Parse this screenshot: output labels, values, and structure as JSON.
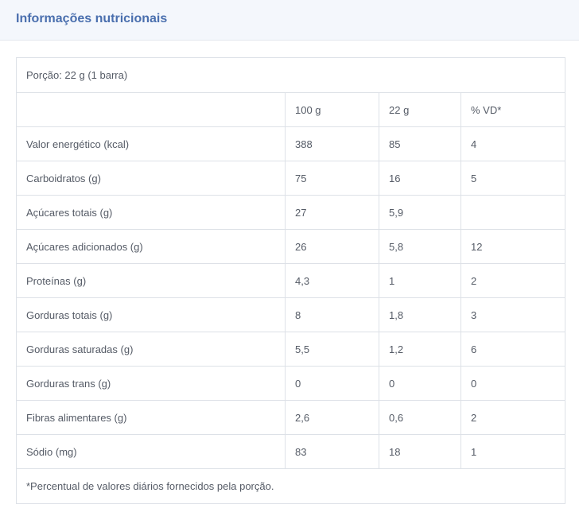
{
  "header": {
    "title": "Informações nutricionais"
  },
  "portion": "Porção: 22 g (1 barra)",
  "columns": [
    "",
    "100 g",
    "22 g",
    "% VD*"
  ],
  "rows": [
    {
      "nutrient": "Valor energético (kcal)",
      "per100": "388",
      "perPortion": "85",
      "vd": "4"
    },
    {
      "nutrient": "Carboidratos (g)",
      "per100": "75",
      "perPortion": "16",
      "vd": "5"
    },
    {
      "nutrient": "Açúcares totais (g)",
      "per100": "27",
      "perPortion": "5,9",
      "vd": ""
    },
    {
      "nutrient": "Açúcares adicionados (g)",
      "per100": "26",
      "perPortion": "5,8",
      "vd": "12"
    },
    {
      "nutrient": "Proteínas (g)",
      "per100": "4,3",
      "perPortion": "1",
      "vd": "2"
    },
    {
      "nutrient": "Gorduras totais (g)",
      "per100": "8",
      "perPortion": "1,8",
      "vd": "3"
    },
    {
      "nutrient": "Gorduras saturadas (g)",
      "per100": "5,5",
      "perPortion": "1,2",
      "vd": "6"
    },
    {
      "nutrient": "Gorduras trans (g)",
      "per100": "0",
      "perPortion": "0",
      "vd": "0"
    },
    {
      "nutrient": "Fibras alimentares (g)",
      "per100": "2,6",
      "perPortion": "0,6",
      "vd": "2"
    },
    {
      "nutrient": "Sódio (mg)",
      "per100": "83",
      "perPortion": "18",
      "vd": "1"
    }
  ],
  "footnote": "*Percentual de valores diários fornecidos pela porção."
}
